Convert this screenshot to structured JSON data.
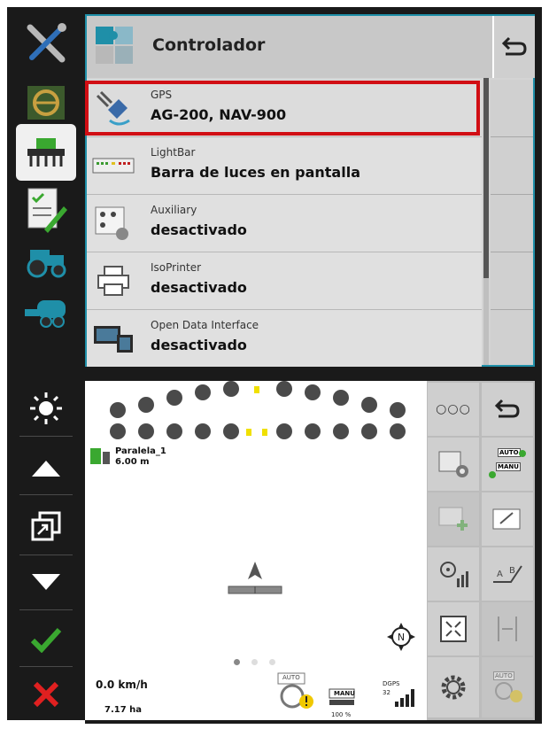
{
  "panel": {
    "title": "Controlador",
    "items": [
      {
        "label": "GPS",
        "value": "AG-200, NAV-900",
        "icon": "satellite-icon"
      },
      {
        "label": "LightBar",
        "value": "Barra de luces en pantalla",
        "icon": "lightbar-icon"
      },
      {
        "label": "Auxiliary",
        "value": "desactivado",
        "icon": "auxiliary-icon"
      },
      {
        "label": "IsoPrinter",
        "value": "desactivado",
        "icon": "printer-icon"
      },
      {
        "label": "Open Data Interface",
        "value": "desactivado",
        "icon": "data-interface-icon"
      }
    ]
  },
  "map": {
    "implement_name": "Paralela_1",
    "implement_width": "6.00 m"
  },
  "status": {
    "speed": "0.0 km/h",
    "area": "7.17 ha",
    "auto_label": "AUTO",
    "manu_label": "MANU",
    "percent": "100 %",
    "gps_mode": "DGPS",
    "gps_number": "32"
  },
  "grid": {
    "more_label": "○○○",
    "auto_manu_top": "AUTO",
    "auto_manu_mid": "MANU",
    "auto_bottom": "AUTO"
  },
  "colors": {
    "accent": "#1f8fa8",
    "selected_outline": "#d10e14",
    "confirm": "#3aa830",
    "cancel": "#e02020"
  }
}
